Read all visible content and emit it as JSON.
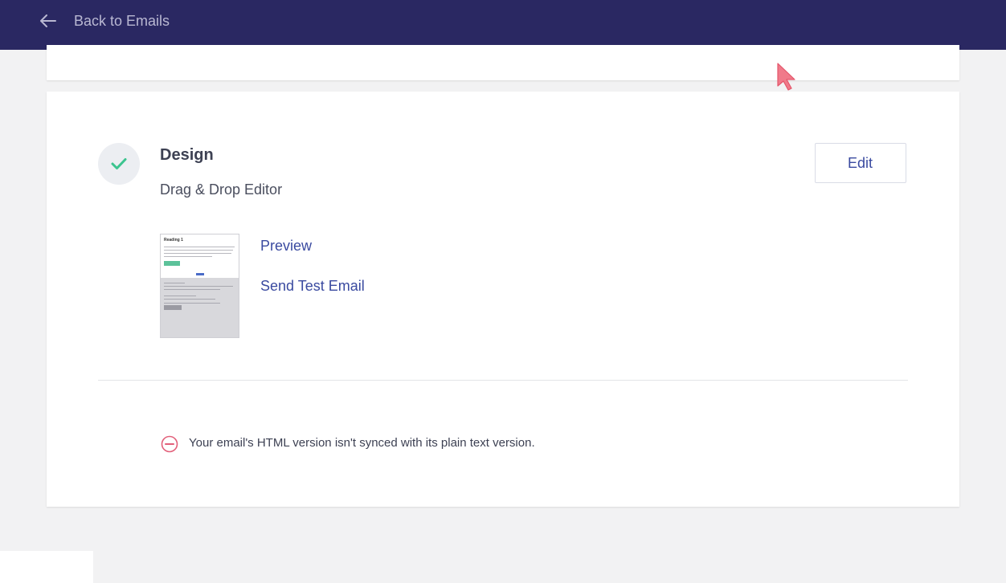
{
  "header": {
    "back_label": "Back to Emails",
    "background": "#2a2862"
  },
  "design_section": {
    "title": "Design",
    "subtitle": "Drag & Drop Editor",
    "edit_label": "Edit",
    "status": "complete",
    "check_color": "#3cc48f",
    "thumbnail": {
      "heading": "Reading 1"
    },
    "links": {
      "preview": "Preview",
      "send_test": "Send Test Email"
    },
    "link_color": "#3a4aa0"
  },
  "warning": {
    "text": "Your email's HTML version isn't synced with its plain text version.",
    "icon_color": "#e2607a"
  }
}
